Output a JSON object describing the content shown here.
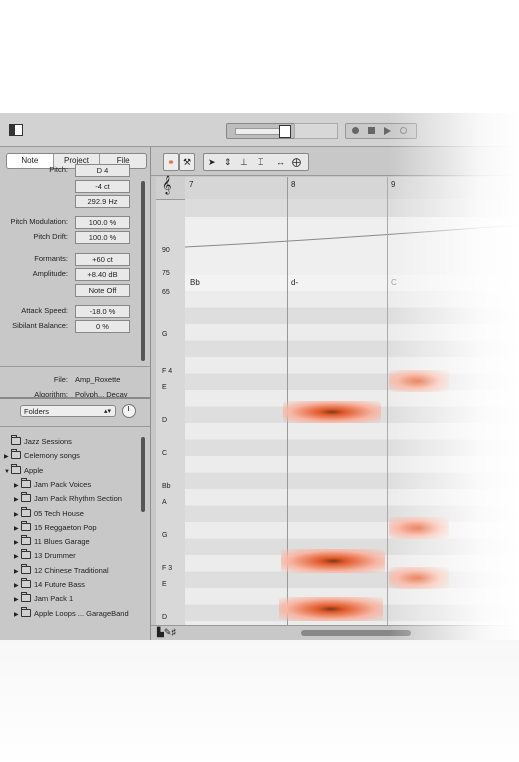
{
  "tabs": [
    "Note",
    "Project",
    "File"
  ],
  "params": [
    {
      "label": "Pitch:",
      "value": "D 4"
    },
    {
      "label": "",
      "value": "-4 ct"
    },
    {
      "label": "",
      "value": "292.9 Hz"
    },
    {
      "label": "Pitch Modulation:",
      "value": "100.0 %"
    },
    {
      "label": "Pitch Drift:",
      "value": "100.0 %"
    },
    {
      "label": "Formants:",
      "value": "+60 ct"
    },
    {
      "label": "Amplitude:",
      "value": "+8.40 dB"
    },
    {
      "label": "",
      "value": "Note Off"
    },
    {
      "label": "Attack Speed:",
      "value": "-18.0 %"
    },
    {
      "label": "Sibilant Balance:",
      "value": "0 %"
    }
  ],
  "info": {
    "file_label": "File:",
    "file_value": "Amp_Roxette",
    "algorithm_label": "Algorithm:",
    "algorithm_value": "Polyph... Decay"
  },
  "browser": {
    "select": "Folders",
    "items": [
      {
        "label": "Jazz Sessions",
        "level": 0,
        "expander": "none"
      },
      {
        "label": "Celemony songs",
        "level": 0,
        "expander": "right"
      },
      {
        "label": "Apple",
        "level": 0,
        "expander": "down"
      },
      {
        "label": "Jam Pack Voices",
        "level": 1,
        "expander": "right"
      },
      {
        "label": "Jam Pack Rhythm Section",
        "level": 1,
        "expander": "right"
      },
      {
        "label": "05 Tech House",
        "level": 1,
        "expander": "right"
      },
      {
        "label": "15 Reggaeton Pop",
        "level": 1,
        "expander": "right"
      },
      {
        "label": "11 Blues Garage",
        "level": 1,
        "expander": "right"
      },
      {
        "label": "13 Drummer",
        "level": 1,
        "expander": "right"
      },
      {
        "label": "12 Chinese Traditional",
        "level": 1,
        "expander": "right"
      },
      {
        "label": "14 Future Bass",
        "level": 1,
        "expander": "right"
      },
      {
        "label": "Jam Pack 1",
        "level": 1,
        "expander": "right"
      },
      {
        "label": "Apple Loops ... GarageBand",
        "level": 1,
        "expander": "right"
      }
    ]
  },
  "ruler": [
    "7",
    "8",
    "9"
  ],
  "amp_ticks": [
    "90",
    "75",
    "65"
  ],
  "chords": [
    "Bb",
    "d-",
    "C"
  ],
  "keys": [
    "G",
    "F 4",
    "E",
    "D",
    "C",
    "Bb",
    "A",
    "G",
    "F 3",
    "E",
    "D"
  ],
  "colors": {
    "blob_outer": "#f7b6a4",
    "blob_inner": "#e05a2a",
    "blob_core": "#7a3a1a"
  }
}
